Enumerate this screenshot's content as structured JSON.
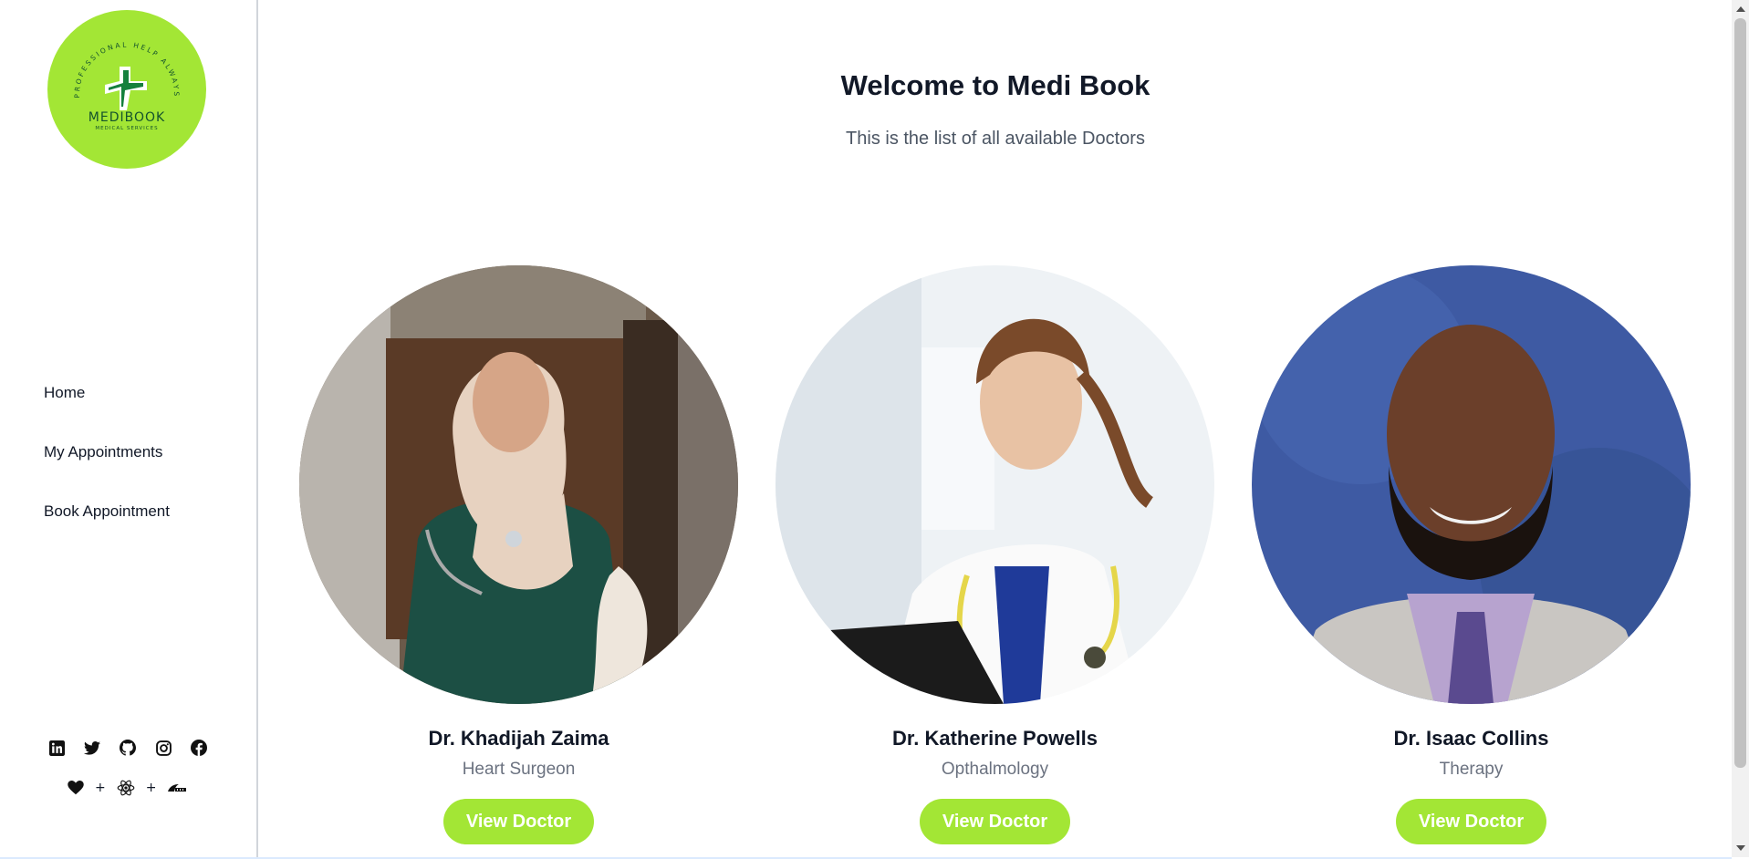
{
  "brand": {
    "name": "MEDIBOOK",
    "tagline": "MEDICAL SERVICES",
    "arc_text": "PROFESSIONAL HELP ALWAYS",
    "color": "#a3e635",
    "dark_green": "#15803d"
  },
  "sidebar": {
    "nav": [
      {
        "label": "Home"
      },
      {
        "label": "My Appointments"
      },
      {
        "label": "Book Appointment"
      }
    ],
    "socials": [
      "linkedin-icon",
      "twitter-icon",
      "github-icon",
      "instagram-icon",
      "facebook-icon"
    ],
    "built_with": {
      "icons": [
        "heart-icon",
        "react-icon",
        "rails-icon"
      ],
      "separator": "+"
    }
  },
  "main": {
    "title": "Welcome to Medi Book",
    "subtitle": "This is the list of all available Doctors",
    "doctors": [
      {
        "name": "Dr. Khadijah Zaima",
        "specialty": "Heart Surgeon",
        "button": "View Doctor"
      },
      {
        "name": "Dr. Katherine Powells",
        "specialty": "Opthalmology",
        "button": "View Doctor"
      },
      {
        "name": "Dr. Isaac Collins",
        "specialty": "Therapy",
        "button": "View Doctor"
      }
    ]
  }
}
